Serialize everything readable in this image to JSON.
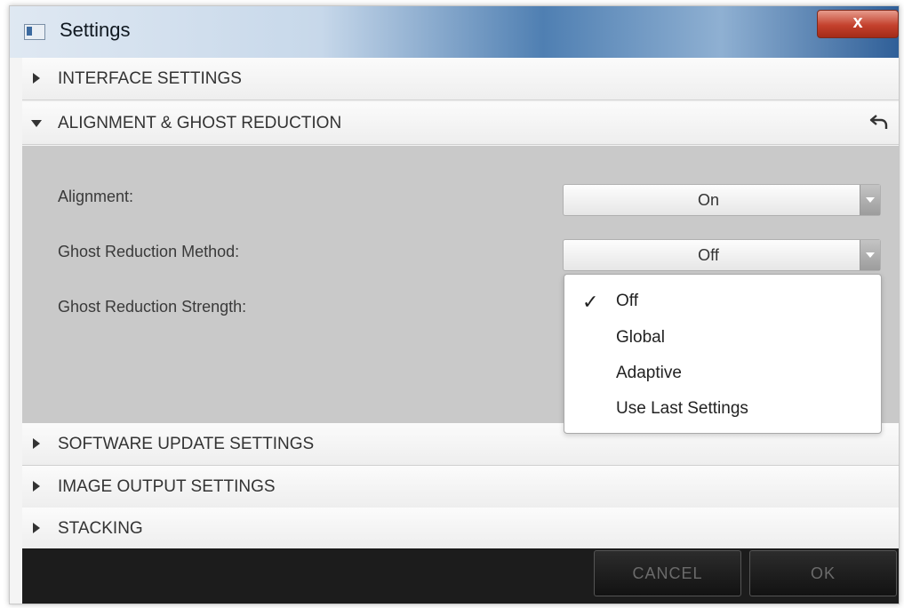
{
  "window": {
    "title": "Settings",
    "close_symbol": "x"
  },
  "sections": {
    "interface": {
      "label": "INTERFACE SETTINGS",
      "expanded": false
    },
    "alignment": {
      "label": "ALIGNMENT & GHOST REDUCTION",
      "expanded": true
    },
    "software_update": {
      "label": "SOFTWARE UPDATE SETTINGS",
      "expanded": false
    },
    "image_output": {
      "label": "IMAGE OUTPUT SETTINGS",
      "expanded": false
    },
    "stacking": {
      "label": "STACKING",
      "expanded": false
    }
  },
  "alignment_panel": {
    "alignment": {
      "label": "Alignment:",
      "value": "On"
    },
    "ghost_method": {
      "label": "Ghost Reduction Method:",
      "value": "Off"
    },
    "ghost_strength": {
      "label": "Ghost Reduction Strength:"
    }
  },
  "ghost_method_menu": {
    "check_symbol": "✓",
    "selected": "Off",
    "options": [
      "Off",
      "Global",
      "Adaptive",
      "Use Last Settings"
    ]
  },
  "footer": {
    "cancel_label": "CANCEL",
    "ok_label": "OK"
  },
  "icons": {
    "expand_collapse": "triangle-icon",
    "reset": "undo-icon",
    "dropdown": "chevron-down-icon"
  },
  "colors": {
    "titlebar_accent": "#4f7fb2",
    "close_button": "#c4412d",
    "panel_bg": "#c9c9c9",
    "footer_bg": "#1c1c1c"
  }
}
